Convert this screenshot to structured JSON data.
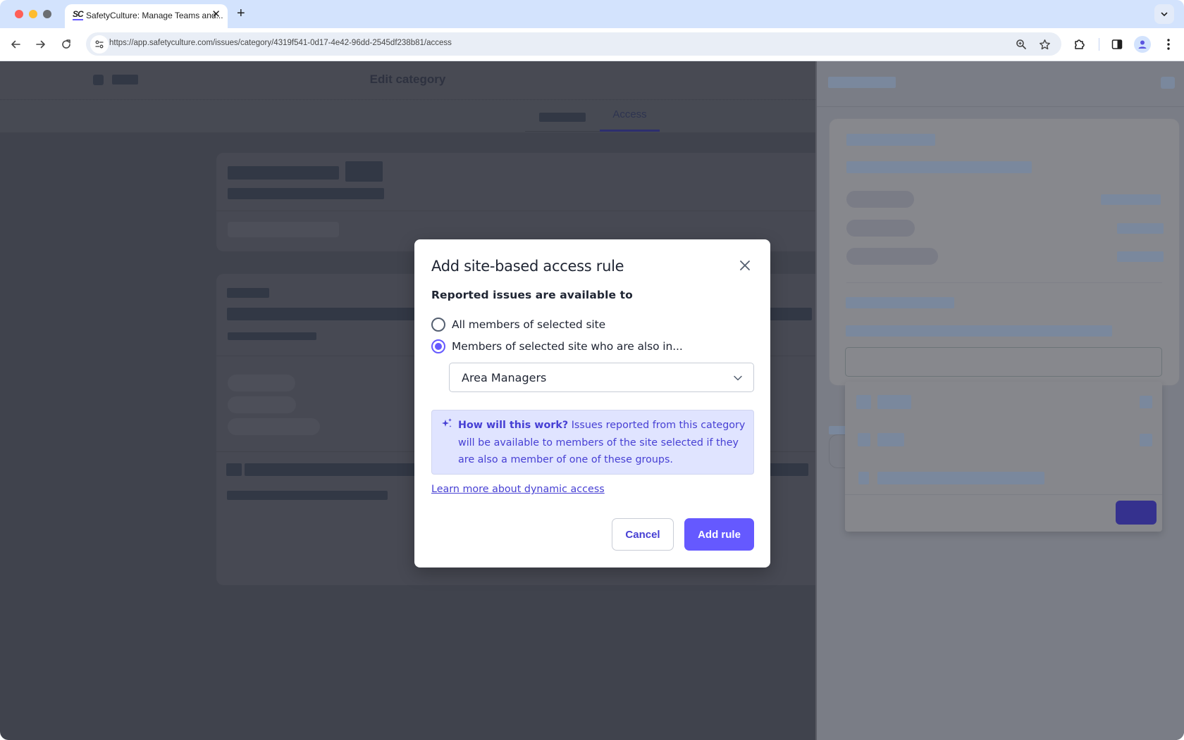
{
  "browser": {
    "tab": {
      "favicon_text": "SC",
      "title": "SafetyCulture: Manage Teams and...",
      "close_glyph": "✕"
    },
    "new_tab_glyph": "+",
    "url": "https://app.safetyculture.com/issues/category/4319f541-0d17-4e42-96dd-2545df238b81/access",
    "icons": [
      "back-arrow",
      "forward-arrow",
      "reload",
      "site-settings",
      "zoom",
      "bookmark-star",
      "extensions",
      "side-panel",
      "profile",
      "more-menu",
      "tab-search-chevron"
    ]
  },
  "page": {
    "title": "Edit category",
    "tabs": [
      {
        "label": "",
        "active": false,
        "skeleton": true
      },
      {
        "label": "Access",
        "active": true
      }
    ]
  },
  "modal": {
    "title": "Add site-based access rule",
    "subtitle": "Reported issues are available to",
    "options": [
      {
        "label": "All members of selected site",
        "checked": false
      },
      {
        "label": "Members of selected site who are also in...",
        "checked": true
      }
    ],
    "select": {
      "value": "Area Managers"
    },
    "info": {
      "icon": "sparkle-icon",
      "bold": "How will this work?",
      "text": " Issues reported from this category will be available to members of the site selected if they are also a member of one of these groups."
    },
    "link": "Learn more about dynamic access",
    "cancel_label": "Cancel",
    "submit_label": "Add rule"
  },
  "colors": {
    "accent": "#6559ff",
    "accent_text": "#4740d4",
    "info_bg": "#e0e4ff",
    "overlay_page": "#40434d"
  }
}
